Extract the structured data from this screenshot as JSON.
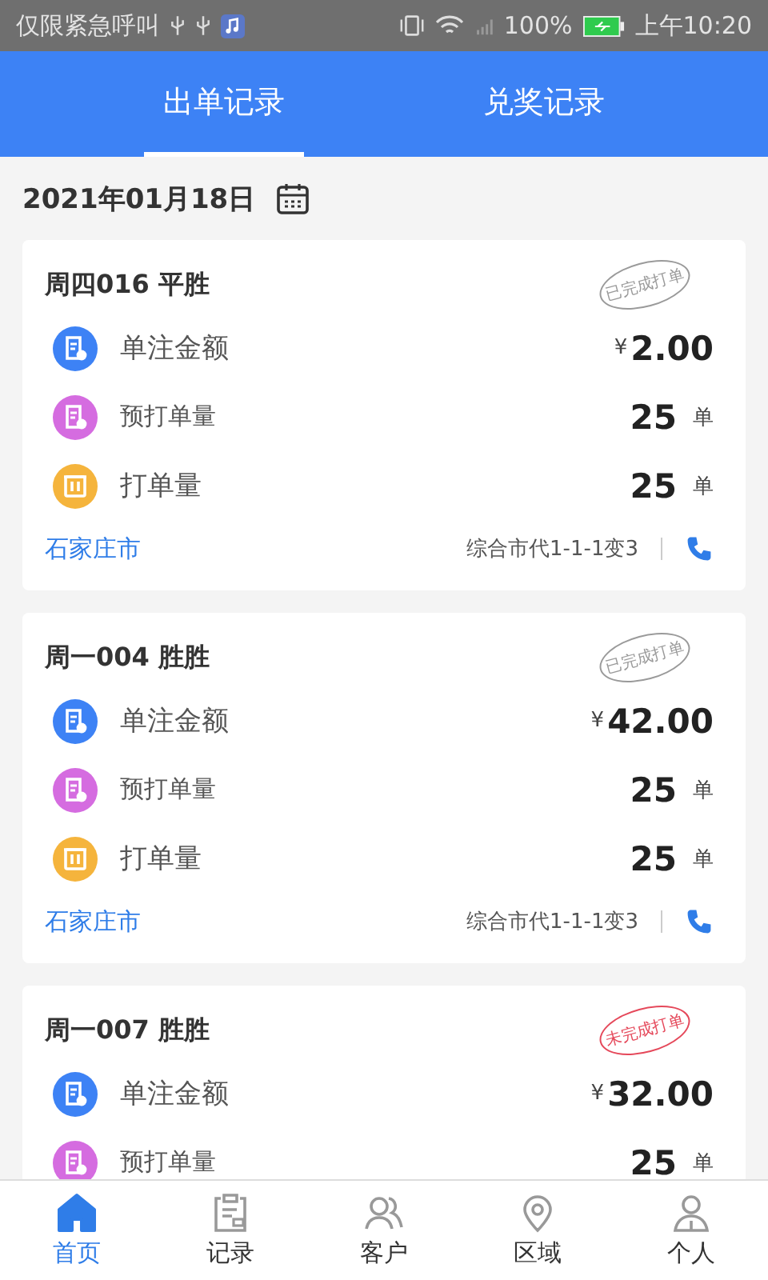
{
  "status_bar": {
    "carrier": "仅限紧急呼叫",
    "battery": "100%",
    "time": "上午10:20"
  },
  "tabs": [
    {
      "label": "出单记录",
      "selected": true
    },
    {
      "label": "兑奖记录",
      "selected": false
    }
  ],
  "date": "2021年01月18日",
  "cards": [
    {
      "title": "周四016 平胜",
      "stamp": {
        "kind": "done",
        "text": "已完成打单"
      },
      "rows": [
        {
          "kind": "amount",
          "label": "单注金额",
          "currency": "¥",
          "value": "2.00"
        },
        {
          "kind": "preorder",
          "label": "预打单量",
          "value": "25",
          "unit": "单"
        },
        {
          "kind": "printed",
          "label": "打单量",
          "value": "25",
          "unit": "单"
        }
      ],
      "city": "石家庄市",
      "agent": "综合市代1-1-1变3"
    },
    {
      "title": "周一004 胜胜",
      "stamp": {
        "kind": "done",
        "text": "已完成打单"
      },
      "rows": [
        {
          "kind": "amount",
          "label": "单注金额",
          "currency": "¥",
          "value": "42.00"
        },
        {
          "kind": "preorder",
          "label": "预打单量",
          "value": "25",
          "unit": "单"
        },
        {
          "kind": "printed",
          "label": "打单量",
          "value": "25",
          "unit": "单"
        }
      ],
      "city": "石家庄市",
      "agent": "综合市代1-1-1变3"
    },
    {
      "title": "周一007 胜胜",
      "stamp": {
        "kind": "pending",
        "text": "未完成打单"
      },
      "rows": [
        {
          "kind": "amount",
          "label": "单注金额",
          "currency": "¥",
          "value": "32.00"
        },
        {
          "kind": "preorder",
          "label": "预打单量",
          "value": "25",
          "unit": "单"
        }
      ]
    }
  ],
  "nav": [
    {
      "kind": "home",
      "label": "首页",
      "selected": true
    },
    {
      "kind": "records",
      "label": "记录",
      "selected": false
    },
    {
      "kind": "customers",
      "label": "客户",
      "selected": false
    },
    {
      "kind": "region",
      "label": "区域",
      "selected": false
    },
    {
      "kind": "person",
      "label": "个人",
      "selected": false
    }
  ]
}
